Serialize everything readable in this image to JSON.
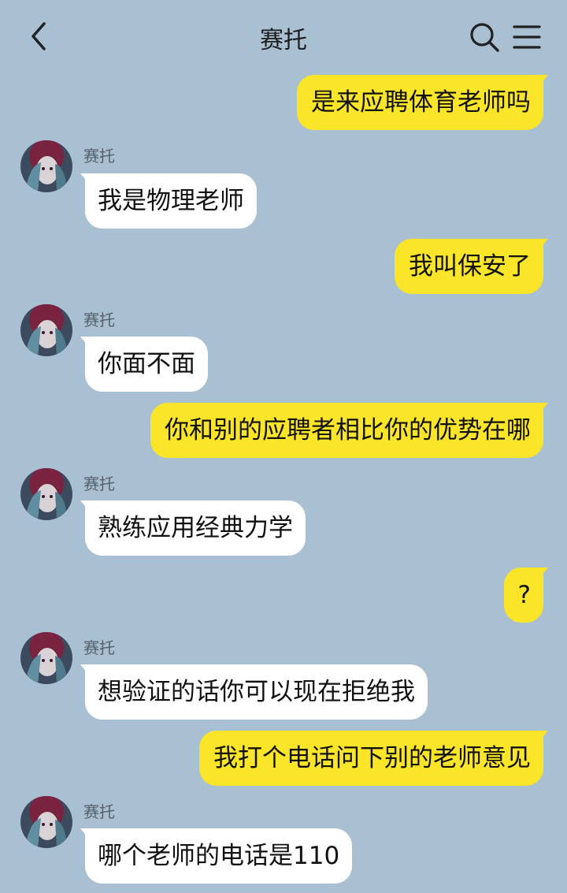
{
  "header": {
    "title": "赛托",
    "back_icon": "chevron-left-icon",
    "search_icon": "search-icon",
    "menu_icon": "menu-icon"
  },
  "colors": {
    "background": "#a9bfd2",
    "outgoing_bubble": "#fbe529",
    "incoming_bubble": "#ffffff"
  },
  "messages": [
    {
      "side": "right",
      "text": "是来应聘体育老师吗"
    },
    {
      "side": "left",
      "sender": "赛托",
      "text": "我是物理老师"
    },
    {
      "side": "right",
      "text": "我叫保安了"
    },
    {
      "side": "left",
      "sender": "赛托",
      "text": "你面不面"
    },
    {
      "side": "right",
      "text": "你和别的应聘者相比你的优势在哪"
    },
    {
      "side": "left",
      "sender": "赛托",
      "text": "熟练应用经典力学"
    },
    {
      "side": "right",
      "text": "?"
    },
    {
      "side": "left",
      "sender": "赛托",
      "text": "想验证的话你可以现在拒绝我"
    },
    {
      "side": "right",
      "text": "我打个电话问下别的老师意见"
    },
    {
      "side": "left",
      "sender": "赛托",
      "text": "哪个老师的电话是110"
    }
  ]
}
